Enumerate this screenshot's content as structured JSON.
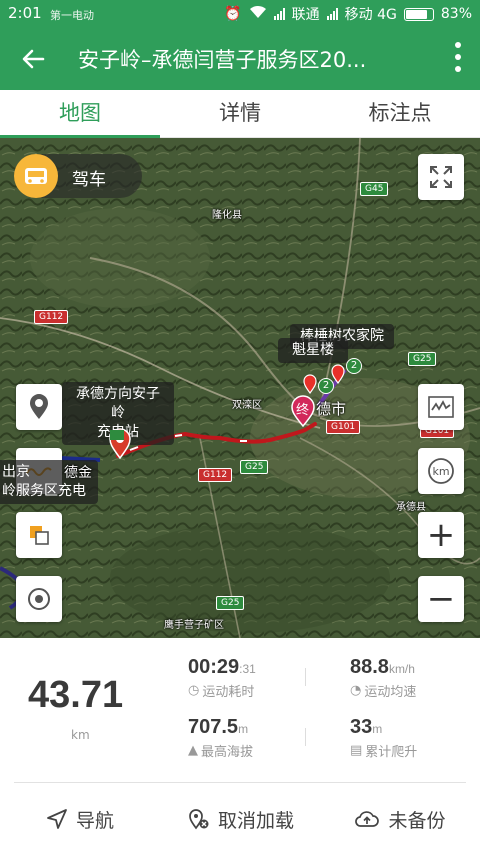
{
  "status": {
    "time": "2:01",
    "brand": "第一电动",
    "carrier1": "联通",
    "carrier2": "移动 4G",
    "battery": "83%",
    "battery_level": 0.83
  },
  "header": {
    "title": "安子岭–承德闫营子服务区20..."
  },
  "tabs": [
    {
      "label": "地图",
      "active": true
    },
    {
      "label": "详情",
      "active": false
    },
    {
      "label": "标注点",
      "active": false
    }
  ],
  "map": {
    "mode_label": "驾车",
    "tooltips": {
      "left_station": [
        "承德方向安子岭",
        "充电站"
      ],
      "left_edge": [
        "出京",
        "岭服务区充电"
      ],
      "left_edge_b": [
        "德金"
      ],
      "right_a": "魁星楼",
      "right_b": "棒棰树农家院"
    },
    "labels": {
      "luanhua": "隆化县",
      "shuangluan": "双滦区",
      "city": "德市",
      "chengde_county": "承德县",
      "yingzi": "鹰手营子矿区"
    },
    "shields": {
      "g45": "G45",
      "g112a": "G112",
      "g112b": "G112",
      "g25a": "G25",
      "g25b": "G25",
      "g25c": "G25",
      "g101": "G101",
      "g101b": "G101"
    },
    "end_marker": "终",
    "waypoint_a": "2",
    "waypoint_b": "2",
    "zoom_in": "+",
    "zoom_out": "−",
    "km_label": "km"
  },
  "stats": {
    "distance": "43.71",
    "distance_unit": "km",
    "duration": "00:29",
    "duration_sec": ":31",
    "duration_label": "运动耗时",
    "avg_speed": "88.8",
    "avg_speed_unit": "km/h",
    "avg_speed_label": "运动均速",
    "max_alt": "707.5",
    "max_alt_unit": "m",
    "max_alt_label": "最高海拔",
    "climb": "33",
    "climb_unit": "m",
    "climb_label": "累计爬升"
  },
  "actions": {
    "navigate": "导航",
    "cancel_load": "取消加载",
    "not_backed_up": "未备份"
  },
  "colors": {
    "brand_green": "#2f9e5a",
    "route_red": "#c0171c",
    "drive_orange": "#f7b73a",
    "marker_pink": "#d2285a"
  }
}
